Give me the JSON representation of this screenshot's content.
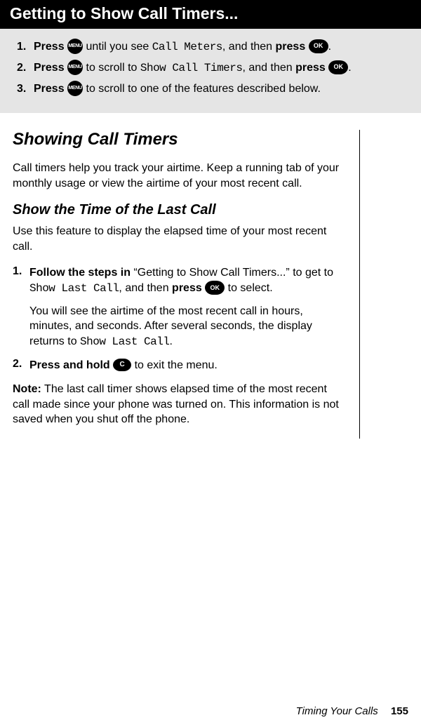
{
  "banner": {
    "title": "Getting to Show Call Timers..."
  },
  "steps_top": [
    {
      "num": "1.",
      "partA": "Press ",
      "btn1": "MENU",
      "partB": " until you see ",
      "mono": "Call Meters",
      "partC": ", and then ",
      "partD": "press ",
      "btn2": "OK",
      "partE": "."
    },
    {
      "num": "2.",
      "partA": "Press ",
      "btn1": "MENU",
      "partB": " to scroll to ",
      "mono": "Show Call Timers",
      "partC": ", and then ",
      "partD": "press ",
      "btn2": "OK",
      "partE": "."
    },
    {
      "num": "3.",
      "partA": "Press ",
      "btn1": "MENU",
      "partB": " to scroll to one of the features described below.",
      "mono": "",
      "partC": "",
      "partD": "",
      "btn2": "",
      "partE": ""
    }
  ],
  "heading1": "Showing Call Timers",
  "para1": "Call timers help you track your airtime. Keep a running tab of your monthly usage or view the airtime of your most recent call.",
  "heading2": "Show the Time of the Last Call",
  "para2": "Use this feature to display the elapsed time of your most recent call.",
  "steps_bottom": {
    "item1": {
      "num": "1.",
      "boldA": "Follow the steps in",
      "textA": " “Getting to Show Call Timers...” to get to ",
      "mono1": "Show Last Call",
      "textB": ", and then ",
      "boldB": "press ",
      "btn": "OK",
      "textC": " to select.",
      "sub": {
        "textA": "You will see the airtime of the most recent call in hours, minutes, and seconds. After several seconds, the display returns to ",
        "mono": "Show Last Call",
        "textB": "."
      }
    },
    "item2": {
      "num": "2.",
      "boldA": "Press and hold ",
      "btn": "C",
      "textA": " to exit the menu."
    }
  },
  "note": {
    "label": "Note:",
    "text": " The last call timer shows elapsed time of the most recent call made since your phone was turned on. This information is not saved when you shut off the phone."
  },
  "footer": {
    "section": "Timing Your Calls",
    "page": "155"
  }
}
